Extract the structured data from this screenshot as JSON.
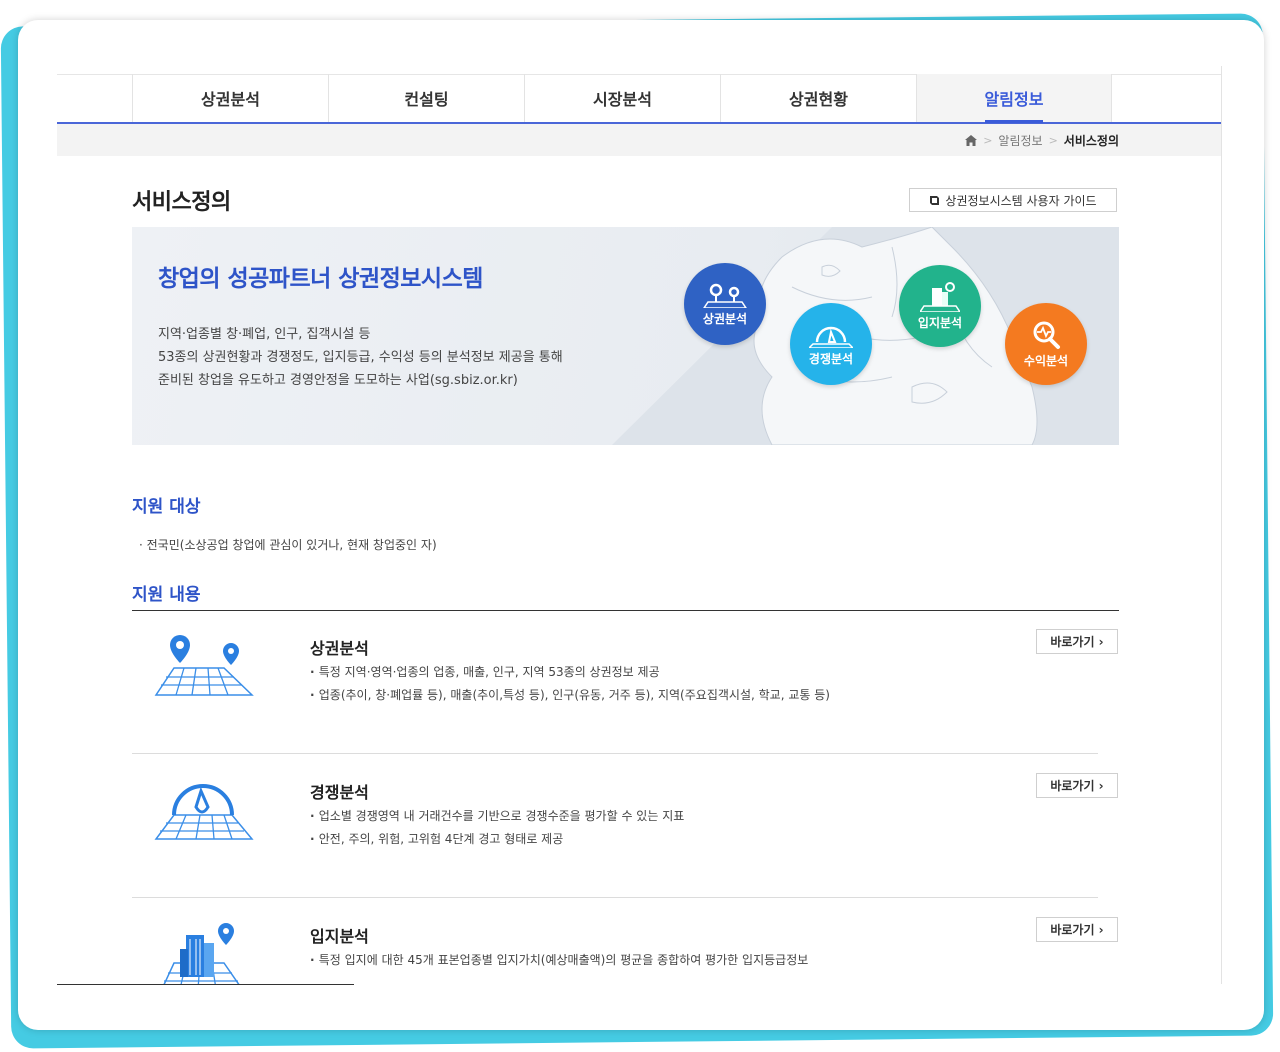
{
  "nav": {
    "tabs": [
      {
        "label": "상권분석"
      },
      {
        "label": "컨설팅"
      },
      {
        "label": "시장분석"
      },
      {
        "label": "상권현황"
      },
      {
        "label": "알림정보",
        "active": true
      }
    ]
  },
  "breadcrumb": {
    "home_icon": "home-icon",
    "sep": ">",
    "parent": "알림정보",
    "current": "서비스정의"
  },
  "page": {
    "title": "서비스정의",
    "guide_button": "상권정보시스템 사용자 가이드",
    "guide_icon": "book-icon"
  },
  "banner": {
    "title": "창업의 성공파트너 상권정보시스템",
    "desc": [
      "지역·업종별 창·폐업, 인구, 집객시설 등",
      "53종의 상권현황과 경쟁정도, 입지등급, 수익성 등의 분석정보 제공을 통해",
      "준비된 창업을 유도하고 경영안정을 도모하는 사업(sg.sbiz.or.kr)"
    ],
    "circles": [
      {
        "label": "상권분석",
        "color": "#2f62c4"
      },
      {
        "label": "경쟁분석",
        "color": "#25b3ea"
      },
      {
        "label": "입지분석",
        "color": "#22b38c"
      },
      {
        "label": "수익분석",
        "color": "#f47a20"
      }
    ]
  },
  "support": {
    "target_heading": "지원 대상",
    "target_text": "전국민(소상공업 창업에 관심이 있거나, 현재 창업중인 자)",
    "content_heading": "지원 내용",
    "go_label": "바로가기 ›",
    "services": [
      {
        "name": "상권분석",
        "lines": [
          "특정 지역·영역·업종의 업종, 매출, 인구, 지역 53종의 상권정보 제공",
          "업종(추이, 창·폐업률 등), 매출(추이,특성 등), 인구(유동, 거주 등), 지역(주요집객시설, 학교, 교통 등)"
        ]
      },
      {
        "name": "경쟁분석",
        "lines": [
          "업소별 경쟁영역 내 거래건수를 기반으로 경쟁수준을 평가할 수 있는 지표",
          "안전, 주의, 위험, 고위험 4단계 경고 형태로 제공"
        ]
      },
      {
        "name": "입지분석",
        "lines": [
          "특정 입지에 대한 45개 표본업종별 입지가치(예상매출액)의 평균을 종합하여 평가한 입지등급정보"
        ]
      }
    ]
  },
  "colors": {
    "accent": "#2e54c8",
    "nav_underline": "#4a66d8",
    "frame_accent": "#45cbe3"
  }
}
